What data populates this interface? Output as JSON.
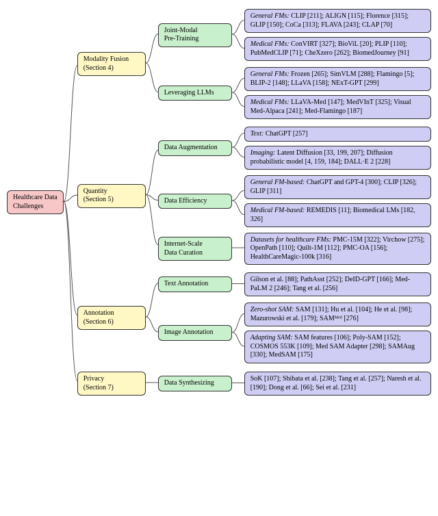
{
  "root": {
    "label": "Healthcare Data\nChallenges"
  },
  "sections": [
    {
      "label": "Modality Fusion\n(Section 4)",
      "groups": [
        {
          "label": "Joint-Modal\nPre-Training",
          "leaves": [
            {
              "prefix": "General FMs:",
              "text": " CLIP [211]; ALIGN [115]; Florence [315]; GLIP [150]; CoCa [313]; FLAVA [243]; CLAP [70]"
            },
            {
              "prefix": "Medical FMs:",
              "text": " ConVIRT [327]; BioViL [20]; PLIP [110]; PubMedCLIP [71]; CheXzero [262]; BiomedJourney [91]"
            }
          ]
        },
        {
          "label": "Leveraging LLMs",
          "leaves": [
            {
              "prefix": "General FMs:",
              "text": " Frozen [265]; SimVLM [288]; Flamingo [5]; BLIP-2 [148]; LLaVA [158]; NExT-GPT [299]"
            },
            {
              "prefix": "Medical FMs:",
              "text": " LLaVA-Med [147]; MedVInT [325]; Visual Med-Alpaca [241]; Med-Flamingo [187]"
            }
          ]
        }
      ]
    },
    {
      "label": "Quantity\n(Section 5)",
      "groups": [
        {
          "label": "Data Augmentation",
          "leaves": [
            {
              "prefix": "Text:",
              "text": " ChatGPT [257]"
            },
            {
              "prefix": "Imaging:",
              "text": " Latent Diffusion [33, 199, 207]; Diffusion probabilistic model [4, 159, 184]; DALL·E 2 [228]"
            }
          ]
        },
        {
          "label": "Data Efficiency",
          "leaves": [
            {
              "prefix": "General FM-based:",
              "text": " ChatGPT and GPT-4 [300]; CLIP [326]; GLIP [311]"
            },
            {
              "prefix": "Medical FM-based:",
              "text": " REMEDIS [11]; Biomedical LMs [182, 326]"
            }
          ]
        },
        {
          "label": "Internet-Scale\nData Curation",
          "leaves": [
            {
              "prefix": "Datasets for healthcare FMs:",
              "text": " PMC-15M [322]; Virchow [275]; OpenPath [110]; Quilt-1M [112]; PMC-OA [156]; HealthCareMagic-100k [316]"
            }
          ]
        }
      ]
    },
    {
      "label": "Annotation\n(Section 6)",
      "groups": [
        {
          "label": "Text Annotation",
          "leaves": [
            {
              "prefix": "",
              "text": "Gilson et al. [88]; PathAsst [252]; DeID-GPT [166]; Med-PaLM 2 [246]; Tang et al. [256]"
            }
          ]
        },
        {
          "label": "Image Annotation",
          "leaves": [
            {
              "prefix": "Zero-shot SAM:",
              "text": " SAM [131]; Hu et al. [104]; He et al. [98]; Mazurowski et al. [179]; SAMᴹᵉᵈ [276]"
            },
            {
              "prefix": "Adapting SAM:",
              "text": " SAM features [106]; Poly-SAM [152]; COSMOS 553K [109]; Med SAM Adapter [298]; SAMAug [330]; MedSAM [175]"
            }
          ]
        }
      ]
    },
    {
      "label": "Privacy\n(Section 7)",
      "groups": [
        {
          "label": "Data Synthesizing",
          "leaves": [
            {
              "prefix": "",
              "text": "SoK [107]; Shibata et al. [238]; Tang et al. [257]; Naresh et al. [190]; Dong et al. [66]; Sei et al. [231]"
            }
          ]
        }
      ]
    }
  ]
}
